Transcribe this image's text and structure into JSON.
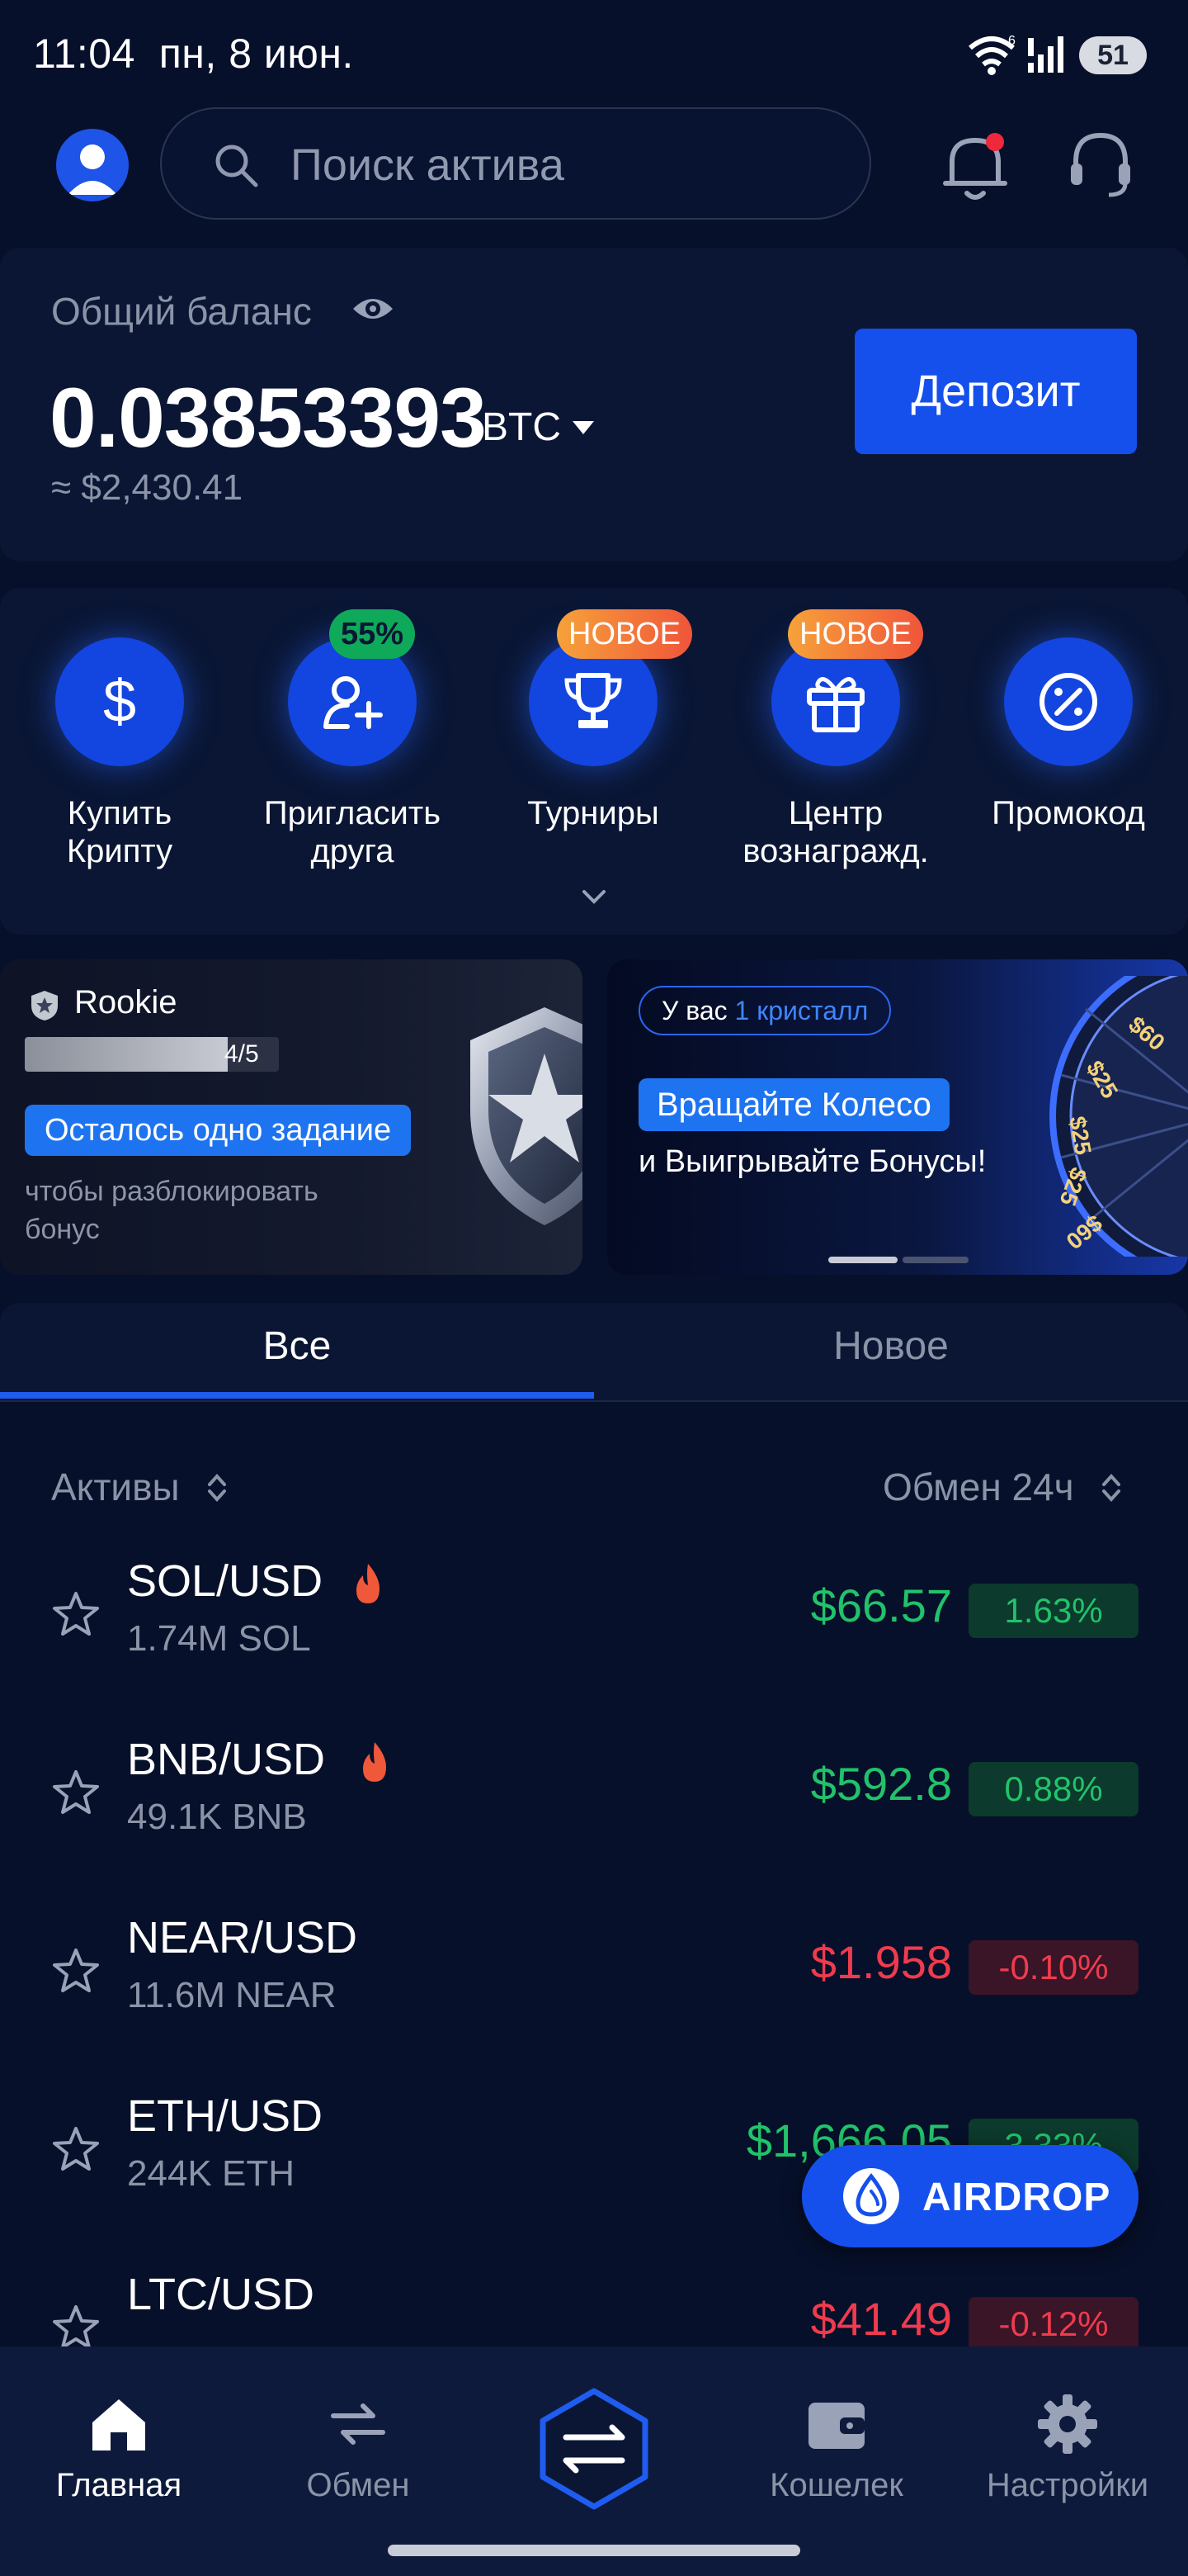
{
  "status_bar": {
    "time": "11:04",
    "date": "пн, 8 июн.",
    "battery": "51",
    "wifi_badge": "6"
  },
  "search": {
    "placeholder": "Поиск актива"
  },
  "balance": {
    "label": "Общий баланс",
    "value": "0.03853393",
    "unit": "BTC",
    "usd": "≈ $2,430.41",
    "deposit_label": "Депозит"
  },
  "actions": [
    {
      "label": "Купить\nКрипту",
      "icon": "dollar-icon",
      "badge": ""
    },
    {
      "label": "Пригласить\nдруга",
      "icon": "add-user-icon",
      "badge": "55%"
    },
    {
      "label": "Турниры",
      "icon": "trophy-icon",
      "badge": "НОВОЕ"
    },
    {
      "label": "Центр\nвознагражд.",
      "icon": "gift-icon",
      "badge": "НОВОЕ"
    },
    {
      "label": "Промокод",
      "icon": "percent-icon",
      "badge": ""
    }
  ],
  "rookie_banner": {
    "title": "Rookie",
    "progress_text": "4/5",
    "progress_fraction": 0.8,
    "task_label": "Осталось одно задание",
    "description": "чтобы разблокировать бонус"
  },
  "wheel_banner": {
    "crystal_prefix": "У вас",
    "crystal_count": "1 кристалл",
    "cta": "Вращайте Колесо",
    "subtitle": "и Выигрывайте Бонусы!",
    "wheel_values": [
      "$60",
      "$25",
      "$25",
      "$25",
      "$60"
    ]
  },
  "tabs": [
    {
      "label": "Все",
      "active": true
    },
    {
      "label": "Новое",
      "active": false
    }
  ],
  "list_header": {
    "assets": "Активы",
    "change": "Обмен 24ч"
  },
  "assets": [
    {
      "pair": "SOL/USD",
      "volume": "1.74M SOL",
      "price": "$66.57",
      "change": "1.63%",
      "direction": "up",
      "hot": true
    },
    {
      "pair": "BNB/USD",
      "volume": "49.1K BNB",
      "price": "$592.8",
      "change": "0.88%",
      "direction": "up",
      "hot": true
    },
    {
      "pair": "NEAR/USD",
      "volume": "11.6M NEAR",
      "price": "$1.958",
      "change": "-0.10%",
      "direction": "down",
      "hot": false
    },
    {
      "pair": "ETH/USD",
      "volume": "244K ETH",
      "price": "$1,666.05",
      "change": "3.33%",
      "direction": "up",
      "hot": false
    },
    {
      "pair": "LTC/USD",
      "volume": "",
      "price": "$41.49",
      "change": "-0.12%",
      "direction": "down",
      "hot": false
    }
  ],
  "airdrop": {
    "label": "AIRDROP"
  },
  "bottom_nav": [
    {
      "label": "Главная",
      "icon": "home-icon",
      "active": true
    },
    {
      "label": "Обмен",
      "icon": "exchange-arrows-icon",
      "active": false
    },
    {
      "label": "",
      "icon": "swap-hexagon-icon",
      "active": false
    },
    {
      "label": "Кошелек",
      "icon": "wallet-icon",
      "active": false
    },
    {
      "label": "Настройки",
      "icon": "gear-icon",
      "active": false
    }
  ],
  "colors": {
    "background": "#07102a",
    "card": "#0a1634",
    "accent": "#1550ec",
    "positive": "#21c36a",
    "negative": "#ef3b4e",
    "muted_text": "#8b93a7"
  }
}
